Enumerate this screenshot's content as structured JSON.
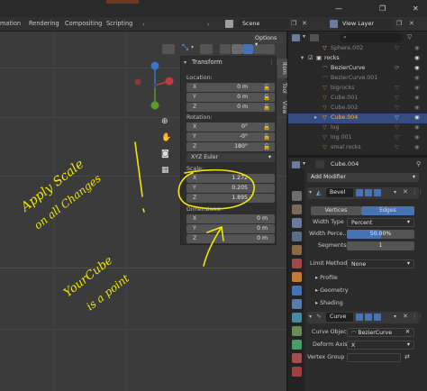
{
  "titlebar": {
    "minimize": "—",
    "restore": "❐",
    "close": "✕"
  },
  "menubar": {
    "tabs": [
      "mation",
      "Rendering",
      "Compositing",
      "Scripting"
    ],
    "scene": "Scene",
    "view_layer": "View Layer"
  },
  "viewport": {
    "options": "Options",
    "nav_icons": [
      "zoom-icon",
      "hand-icon",
      "camera-icon",
      "grid-icon"
    ]
  },
  "npanel": {
    "header": "Transform",
    "location_label": "Location:",
    "location": [
      [
        "X",
        "0 m"
      ],
      [
        "Y",
        "0 m"
      ],
      [
        "Z",
        "0 m"
      ]
    ],
    "rotation_label": "Rotation:",
    "rotation": [
      [
        "X",
        "0°"
      ],
      [
        "Y",
        "-0°"
      ],
      [
        "Z",
        "180°"
      ]
    ],
    "rotation_mode": "XYZ Euler",
    "scale_label": "Scale:",
    "scale": [
      [
        "X",
        "1.272"
      ],
      [
        "Y",
        "0.205"
      ],
      [
        "Z",
        "1.895"
      ]
    ],
    "dimensions_label": "Dimensions:",
    "dimensions": [
      [
        "X",
        "0 m"
      ],
      [
        "Y",
        "0 m"
      ],
      [
        "Z",
        "0 m"
      ]
    ],
    "tabs": [
      "Item",
      "Tool",
      "View"
    ]
  },
  "outliner": {
    "rows": [
      {
        "name": "Sphere.002",
        "dim": true
      },
      {
        "name": "rocks",
        "dim": false,
        "collection": true
      },
      {
        "name": "BezierCurve",
        "dim": false
      },
      {
        "name": "BezierCurve.001",
        "dim": true
      },
      {
        "name": "bigrocks",
        "dim": true
      },
      {
        "name": "Cube.001",
        "dim": true
      },
      {
        "name": "Cube.002",
        "dim": true
      },
      {
        "name": "Cube.004",
        "dim": false,
        "selected": true
      },
      {
        "name": "log",
        "dim": true
      },
      {
        "name": "log.001",
        "dim": true
      },
      {
        "name": "smal rocks",
        "dim": true
      }
    ]
  },
  "properties": {
    "object_name": "Cube.004",
    "add_modifier": "Add Modifier",
    "bevel": {
      "name": "Bevel",
      "vertices": "Vertices",
      "edges": "Edges",
      "width_type_label": "Width Type",
      "width_type": "Percent",
      "width_percent_label": "Width Perce...",
      "width_percent": "50.00%",
      "width_percent_fraction": 0.5,
      "segments_label": "Segments",
      "segments": "1",
      "limit_method_label": "Limit Method",
      "limit_method": "None",
      "profile": "Profile",
      "geometry": "Geometry",
      "shading": "Shading"
    },
    "curve": {
      "name": "Curve",
      "curve_object_label": "Curve Object",
      "curve_object": "BezierCurve",
      "deform_axis_label": "Deform Axis",
      "deform_axis": "X",
      "vertex_group_label": "Vertex Group"
    }
  },
  "annotations": {
    "note1_line1": "Apply Scale",
    "note1_line2": "on all Changes",
    "note2_line1": "YourCube",
    "note2_line2": "is a point",
    "color": "#f2e600"
  },
  "colors": {
    "accent_blue": "#4772b3",
    "selection": "#334d80",
    "orange": "#e8a53a"
  }
}
